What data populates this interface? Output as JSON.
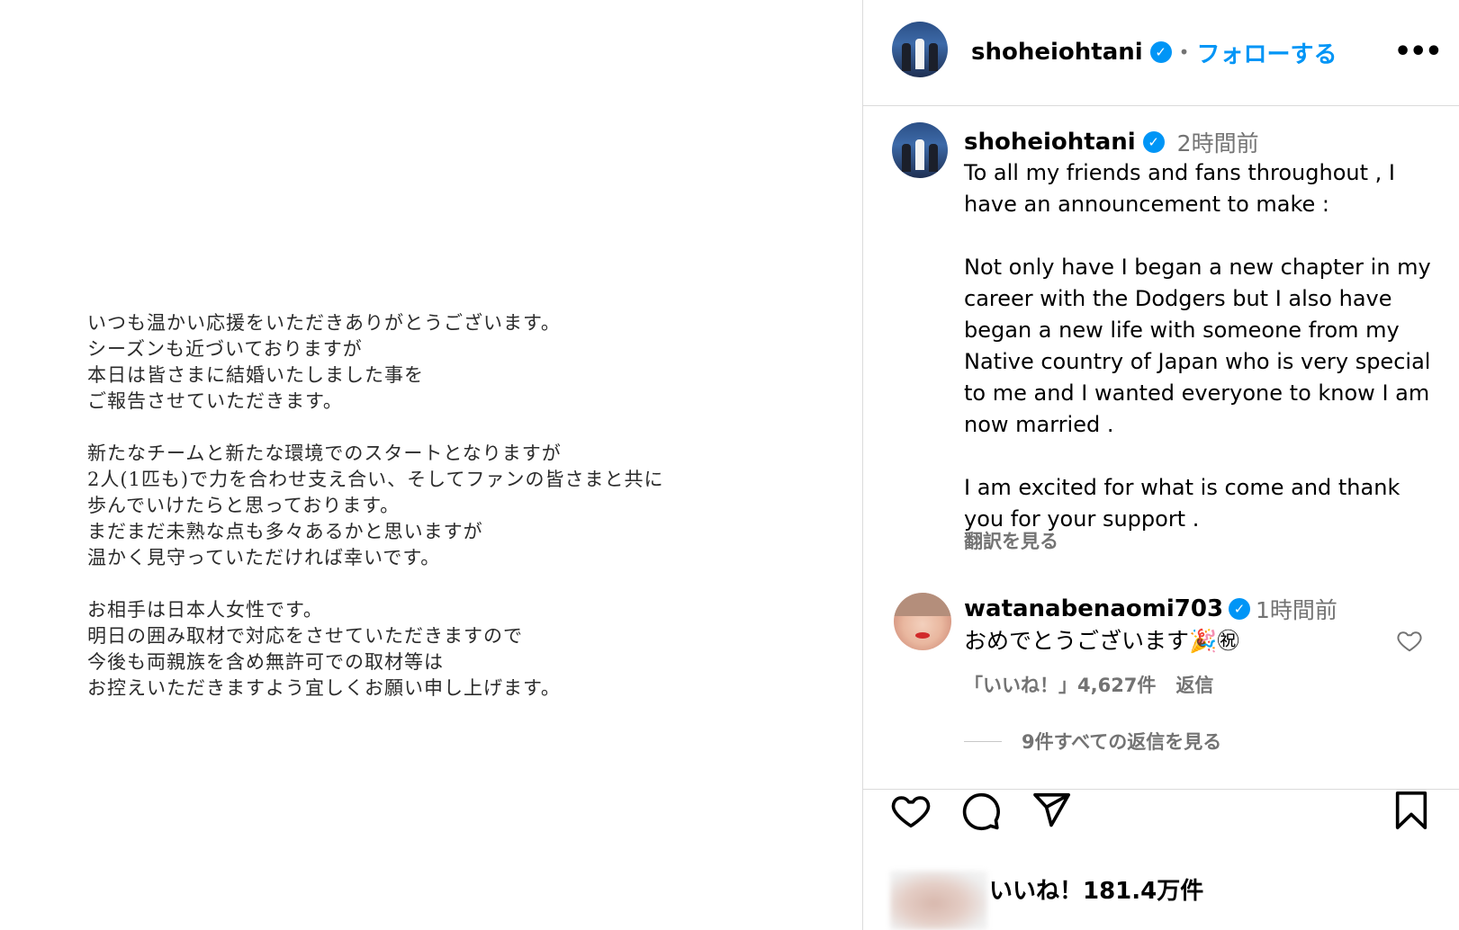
{
  "post_image": {
    "letter_paragraphs": [
      [
        "いつも温かい応援をいただきありがとうございます。",
        "シーズンも近づいておりますが",
        "本日は皆さまに結婚いたしました事を",
        "ご報告させていただきます。"
      ],
      [
        "新たなチームと新たな環境でのスタートとなりますが",
        "2人(1匹も)で力を合わせ支え合い、そしてファンの皆さまと共に",
        "歩んでいけたらと思っております。",
        "まだまだ未熟な点も多々あるかと思いますが",
        "温かく見守っていただければ幸いです。"
      ],
      [
        "お相手は日本人女性です。",
        "明日の囲み取材で対応をさせていただきますので",
        "今後も両親族を含め無許可での取材等は",
        "お控えいただきますよう宜しくお願い申し上げます。"
      ]
    ]
  },
  "header": {
    "username": "shoheiohtani",
    "verified_glyph": "✓",
    "dot": "•",
    "follow_label": "フォローする",
    "more_label": "•••"
  },
  "caption": {
    "username": "shoheiohtani",
    "time": "2時間前",
    "paragraphs": [
      "To all my friends and fans throughout , I have an announcement to make :",
      "Not only have I began a new chapter in my career with the Dodgers but I also have began a new life with someone from my Native country of Japan who is very special to me and I wanted everyone to know I am now married .",
      "I am excited for what is come and thank you for your support ."
    ],
    "translate_label": "翻訳を見る"
  },
  "comment": {
    "username": "watanabenaomi703",
    "time": "1時間前",
    "text": "おめでとうございます🎉㊗",
    "likes_label": "「いいね！」4,627件",
    "reply_label": "返信",
    "view_replies_label": "9件すべての返信を見る"
  },
  "actions": {
    "icons": [
      "heart-icon",
      "comment-icon",
      "share-icon",
      "bookmark-icon"
    ],
    "likes_label": "いいね！181.4万件"
  },
  "colors": {
    "accent": "#0095f6",
    "secondary_text": "#737373",
    "divider": "#dbdbdb"
  }
}
